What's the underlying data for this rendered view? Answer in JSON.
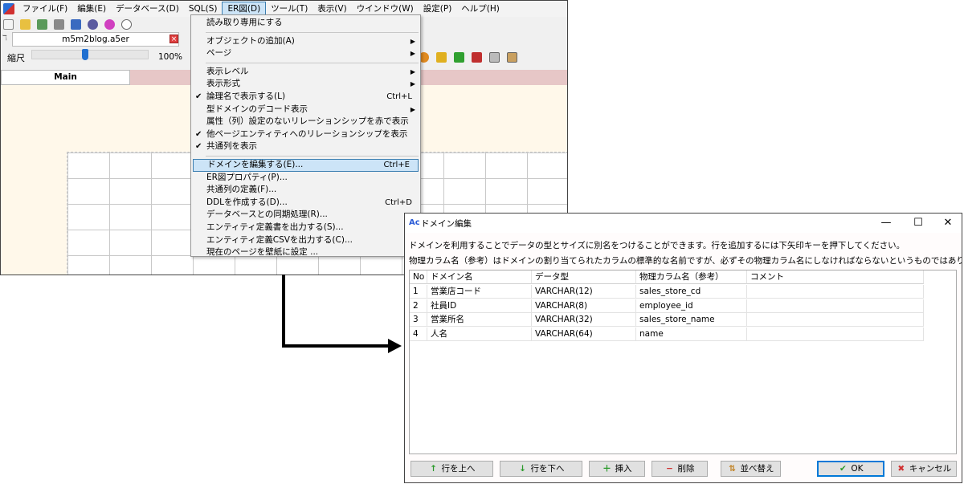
{
  "main_window": {
    "menubar": [
      {
        "label": "ファイル(F)"
      },
      {
        "label": "編集(E)"
      },
      {
        "label": "データベース(D)"
      },
      {
        "label": "SQL(S)"
      },
      {
        "label": "ER図(D)"
      },
      {
        "label": "ツール(T)"
      },
      {
        "label": "表示(V)"
      },
      {
        "label": "ウインドウ(W)"
      },
      {
        "label": "設定(P)"
      },
      {
        "label": "ヘルプ(H)"
      }
    ],
    "doc_tab": {
      "name": "m5m2blog.a5er",
      "mark": "ℸ"
    },
    "zoom": {
      "label": "縮尺",
      "value_text": "100%",
      "level": 0.45
    },
    "main_tab": {
      "label": "Main"
    }
  },
  "er_menu": {
    "items": [
      {
        "label": "読み取り専用にする",
        "check": "",
        "shortcut": "",
        "arrow": ""
      },
      {
        "sep": true
      },
      {
        "label": "オブジェクトの追加(A)",
        "check": "",
        "shortcut": "",
        "arrow": "▶"
      },
      {
        "label": "ページ",
        "check": "",
        "shortcut": "",
        "arrow": "▶"
      },
      {
        "sep": true
      },
      {
        "label": "表示レベル",
        "check": "",
        "shortcut": "",
        "arrow": "▶"
      },
      {
        "label": "表示形式",
        "check": "",
        "shortcut": "",
        "arrow": "▶"
      },
      {
        "label": "論理名で表示する(L)",
        "check": "✔",
        "shortcut": "Ctrl+L",
        "arrow": ""
      },
      {
        "label": "型ドメインのデコード表示",
        "check": "",
        "shortcut": "",
        "arrow": "▶"
      },
      {
        "label": "属性（列）設定のないリレーションシップを赤で表示",
        "check": "",
        "shortcut": "",
        "arrow": ""
      },
      {
        "label": "他ページエンティティへのリレーションシップを表示",
        "check": "✔",
        "shortcut": "",
        "arrow": ""
      },
      {
        "label": "共通列を表示",
        "check": "✔",
        "shortcut": "",
        "arrow": ""
      },
      {
        "sep": true
      },
      {
        "label": "ドメインを編集する(E)...",
        "check": "",
        "shortcut": "Ctrl+E",
        "arrow": "",
        "highlight": true
      },
      {
        "label": "ER図プロパティ(P)...",
        "check": "",
        "shortcut": "",
        "arrow": ""
      },
      {
        "label": "共通列の定義(F)...",
        "check": "",
        "shortcut": "",
        "arrow": ""
      },
      {
        "label": "DDLを作成する(D)...",
        "check": "",
        "shortcut": "Ctrl+D",
        "arrow": ""
      },
      {
        "label": "データベースとの同期処理(R)...",
        "check": "",
        "shortcut": "",
        "arrow": ""
      },
      {
        "label": "エンティティ定義書を出力する(S)...",
        "check": "",
        "shortcut": "",
        "arrow": ""
      },
      {
        "label": "エンティティ定義CSVを出力する(C)...",
        "check": "",
        "shortcut": "",
        "arrow": ""
      },
      {
        "label": "現在のページを壁紙に設定 ...",
        "check": "",
        "shortcut": "",
        "arrow": ""
      }
    ]
  },
  "dialog": {
    "title": "ドメイン編集",
    "icon_text": "Ac",
    "window_buttons": {
      "minimize": "—",
      "maximize": "☐",
      "close": "✕"
    },
    "desc1": "ドメインを利用することでデータの型とサイズに別名をつけることができます。行を追加するには下矢印キーを押下してください。",
    "desc2": "物理カラム名（参考）はドメインの割り当てられたカラムの標準的な名前ですが、必ずその物理カラム名にしなければならないというものではありません。",
    "columns": [
      "No",
      "ドメイン名",
      "データ型",
      "物理カラム名（参考）",
      "コメント"
    ],
    "rows": [
      {
        "no": "1",
        "domain": "営業店コード",
        "type": "VARCHAR(12)",
        "physical": "sales_store_cd",
        "comment": ""
      },
      {
        "no": "2",
        "domain": "社員ID",
        "type": "VARCHAR(8)",
        "physical": "employee_id",
        "comment": ""
      },
      {
        "no": "3",
        "domain": "営業所名",
        "type": "VARCHAR(32)",
        "physical": "sales_store_name",
        "comment": ""
      },
      {
        "no": "4",
        "domain": "人名",
        "type": "VARCHAR(64)",
        "physical": "name",
        "comment": ""
      }
    ],
    "buttons": {
      "row_up": "行を上へ",
      "row_down": "行を下へ",
      "insert": "挿入",
      "delete": "削除",
      "sort": "並べ替え",
      "ok": "OK",
      "cancel": "キャンセル"
    }
  },
  "colors": {
    "accent": "#1f6fd0",
    "menu_highlight": "#cce4f7",
    "canvas_bg": "#fff8ea",
    "tab_bar": "#e7c7c7"
  }
}
